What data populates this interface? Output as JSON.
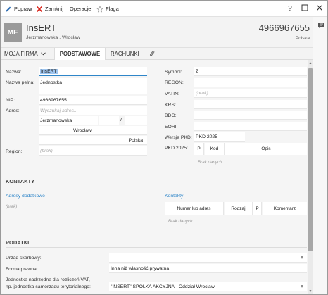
{
  "toolbar": {
    "save_label": "Popraw",
    "close_label": "Zamknij",
    "operations_label": "Operacje",
    "flag_label": "Flaga",
    "help_glyph": "?"
  },
  "header": {
    "avatar_initials": "MF",
    "company_name": "InsERT",
    "city": "Jerzmanowska ,",
    "town": "Wrocław",
    "nip": "4966967655",
    "country": "Polska"
  },
  "tabs": [
    {
      "label": "MOJA FIRMA"
    },
    {
      "label": "PODSTAWOWE"
    },
    {
      "label": "RACHUNKI"
    }
  ],
  "basic": {
    "name_label": "Nazwa:",
    "name_value": "InsERT",
    "full_name_label": "Nazwa pełna:",
    "full_name_value": "Jednostka",
    "nip_label": "NIP:",
    "nip_value": "4966967655",
    "address_label": "Adres:",
    "address_placeholder": "Wyszukaj adres...",
    "street_value": "Jerzmanowska",
    "number_sep": "/",
    "city_value": "Wrocław",
    "country_value": "Polska",
    "region_label": "Region:",
    "region_placeholder": "(brak)"
  },
  "right_fields": {
    "symbol_label": "Symbol:",
    "symbol_value": "Z",
    "regon_label": "REGON:",
    "vatin_label": "VATIN:",
    "vatin_placeholder": "(brak)",
    "krs_label": "KRS:",
    "bdo_label": "BDO:",
    "eori_label": "EORI:",
    "pkd_version_label": "Wersja PKD:",
    "pkd_version_value": "PKD 2025",
    "pkd_label": "PKD 2025:",
    "pkd_columns": [
      "P",
      "Kod",
      "Opis"
    ],
    "pkd_empty": "Brak danych"
  },
  "contacts": {
    "section_title": "KONTAKTY",
    "extra_addresses_link": "Adresy dodatkowe",
    "extra_addresses_empty": "(brak)",
    "contacts_link": "Kontakty",
    "contacts_columns": [
      "Numer lub adres",
      "Rodzaj",
      "P",
      "Komentarz"
    ],
    "contacts_empty": "Brak danych"
  },
  "taxes": {
    "section_title": "PODATKI",
    "tax_office_label": "Urząd skarbowy:",
    "menu_glyph": "≡",
    "legal_form_label": "Forma prawna:",
    "legal_form_value": "Inna niż własność prywatna",
    "parent_unit_label_1": "Jednostka nadrzędna dla rozliczeń VAT,",
    "parent_unit_label_2": "np. jednostka samorządu terytorialnego:",
    "parent_unit_value": "\"INSERT\" SPÓŁKA AKCYJNA - Oddział Wrocław"
  },
  "colors": {
    "accent": "#2f86c9",
    "selection": "#9ec5ef",
    "close_red": "#d9261c"
  }
}
